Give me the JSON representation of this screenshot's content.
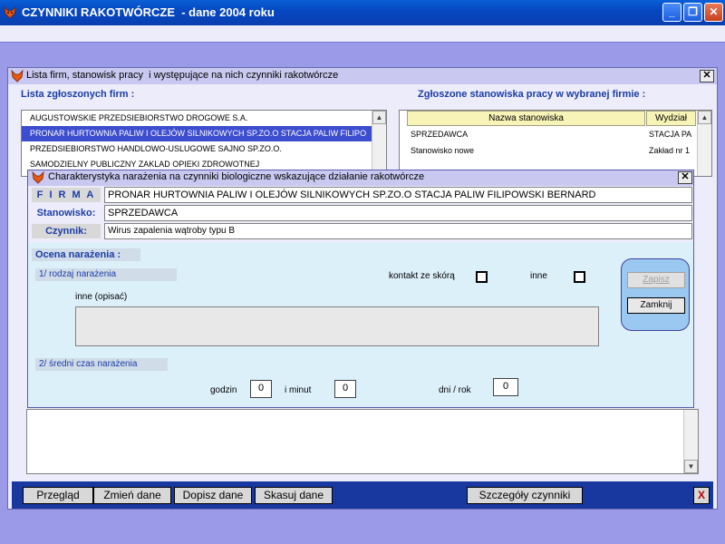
{
  "main_window": {
    "title": "CZYNNIKI RAKOTWÓRCZE  - dane 2004 roku"
  },
  "outer_dialog": {
    "title": "Lista firm, stanowisk pracy  i występujące na nich czynniki rakotwórcze",
    "firm_list_label": "Lista zgłoszonych firm :",
    "firms": [
      "AUGUSTOWSKIE PRZEDSIEBIORSTWO DROGOWE S.A.",
      "PRONAR HURTOWNIA PALIW I OLEJÓW SILNIKOWYCH SP.ZO.O STACJA PALIW FILIPO",
      "PRZEDSIEBIORSTWO HANDLOWO-USLUGOWE SAJNO SP.ZO.O.",
      "SAMODZIELNY PUBLICZNY ZAKLAD OPIEKI ZDROWOTNEJ"
    ],
    "positions_label": "Zgłoszone stanowiska pracy w wybranej firmie :",
    "positions_columns": [
      "Nazwa stanowiska",
      "Wydział"
    ],
    "positions": [
      {
        "name": "SPRZEDAWCA",
        "dept": "STACJA PA"
      },
      {
        "name": "Stanowisko nowe",
        "dept": "Zakład nr 1"
      }
    ],
    "buttons": {
      "preview": "Przegląd",
      "change": "Zmień dane",
      "add": "Dopisz dane",
      "delete": "Skasuj dane",
      "details": "Szczegóły czynniki",
      "close": "X"
    }
  },
  "inner_dialog": {
    "title": "Charakterystyka narażenia na czynniki biologiczne wskazujące działanie rakotwórcze",
    "firma_label": "F I R M A",
    "firma_value": "PRONAR HURTOWNIA PALIW I OLEJÓW SILNIKOWYCH SP.ZO.O STACJA PALIW FILIPOWSKI BERNARD",
    "position_label": "Stanowisko:",
    "position_value": "SPRZEDAWCA",
    "factor_label": "Czynnik:",
    "factor_value": "Wirus zapalenia wątroby typu B",
    "assessment_label": "Ocena narażenia :",
    "exposure_type_label": "1/ rodzaj narażenia",
    "skin_contact_label": "kontakt ze skórą",
    "other_label": "inne",
    "other_describe_label": "inne (opisać)",
    "other_describe_value": "",
    "avg_time_label": "2/ średni czas narażenia",
    "hours_label": "godzin",
    "hours_value": "0",
    "minutes_label": "i  minut",
    "minutes_value": "0",
    "days_label": "dni / rok",
    "days_value": "0",
    "save_button": "Zapisz",
    "close_button": "Zamknij"
  }
}
